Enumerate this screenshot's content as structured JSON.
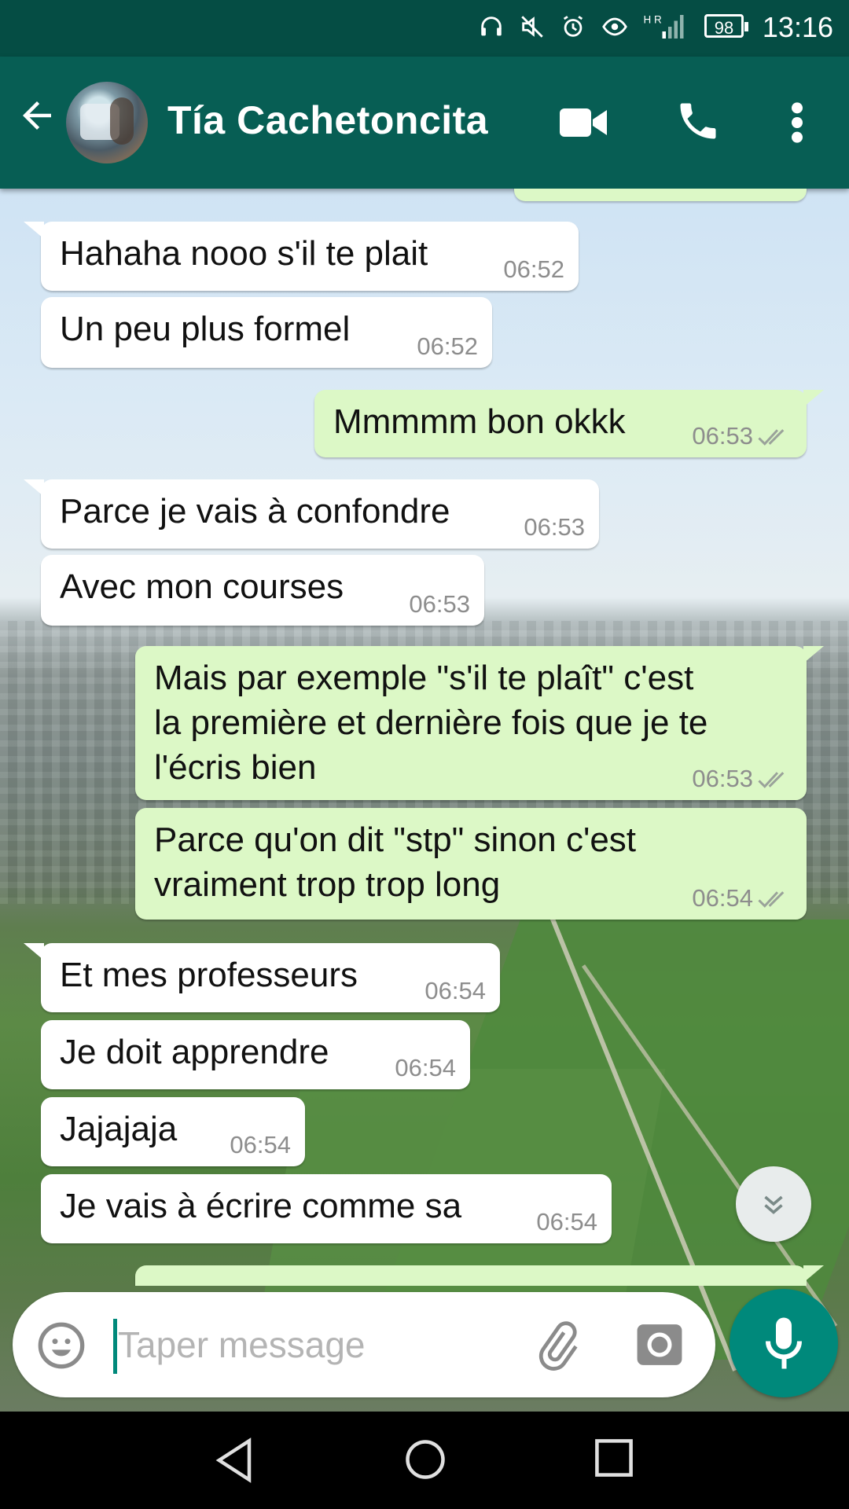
{
  "status_bar": {
    "battery": "98",
    "time": "13:16",
    "network": "H R"
  },
  "header": {
    "contact_name": "Tía Cachetoncita"
  },
  "messages": [
    {
      "dir": "in",
      "text": "Hahaha nooo s'il te plait",
      "time": "06:52"
    },
    {
      "dir": "in",
      "text": "Un peu plus formel",
      "time": "06:52"
    },
    {
      "dir": "out",
      "text": "Mmmmm bon okkk",
      "time": "06:53"
    },
    {
      "dir": "in",
      "text": "Parce je vais à confondre",
      "time": "06:53"
    },
    {
      "dir": "in",
      "text": "Avec mon courses",
      "time": "06:53"
    },
    {
      "dir": "out",
      "text": "Mais par exemple \"s'il te plaît\" c'est\nla première et dernière fois que je te\nl'écris bien",
      "time": "06:53"
    },
    {
      "dir": "out",
      "text": "Parce qu'on dit \"stp\" sinon c'est\nvraiment trop trop long",
      "time": "06:54"
    },
    {
      "dir": "in",
      "text": "Et mes professeurs",
      "time": "06:54"
    },
    {
      "dir": "in",
      "text": "Je doit apprendre",
      "time": "06:54"
    },
    {
      "dir": "in",
      "text": "Jajajaja",
      "time": "06:54"
    },
    {
      "dir": "in",
      "text": "Je vais à écrire comme sa",
      "time": "06:54"
    }
  ],
  "composer": {
    "placeholder": "Taper message"
  },
  "colors": {
    "header": "#075e54",
    "status_bar": "#054d44",
    "accent": "#00897b",
    "outgoing_bubble": "#dcf8c6",
    "incoming_bubble": "#ffffff"
  },
  "icons": [
    "back-arrow-icon",
    "video-call-icon",
    "phone-icon",
    "more-vert-icon",
    "emoji-icon",
    "attach-icon",
    "camera-icon",
    "mic-icon",
    "scroll-down-icon",
    "double-check-icon"
  ]
}
